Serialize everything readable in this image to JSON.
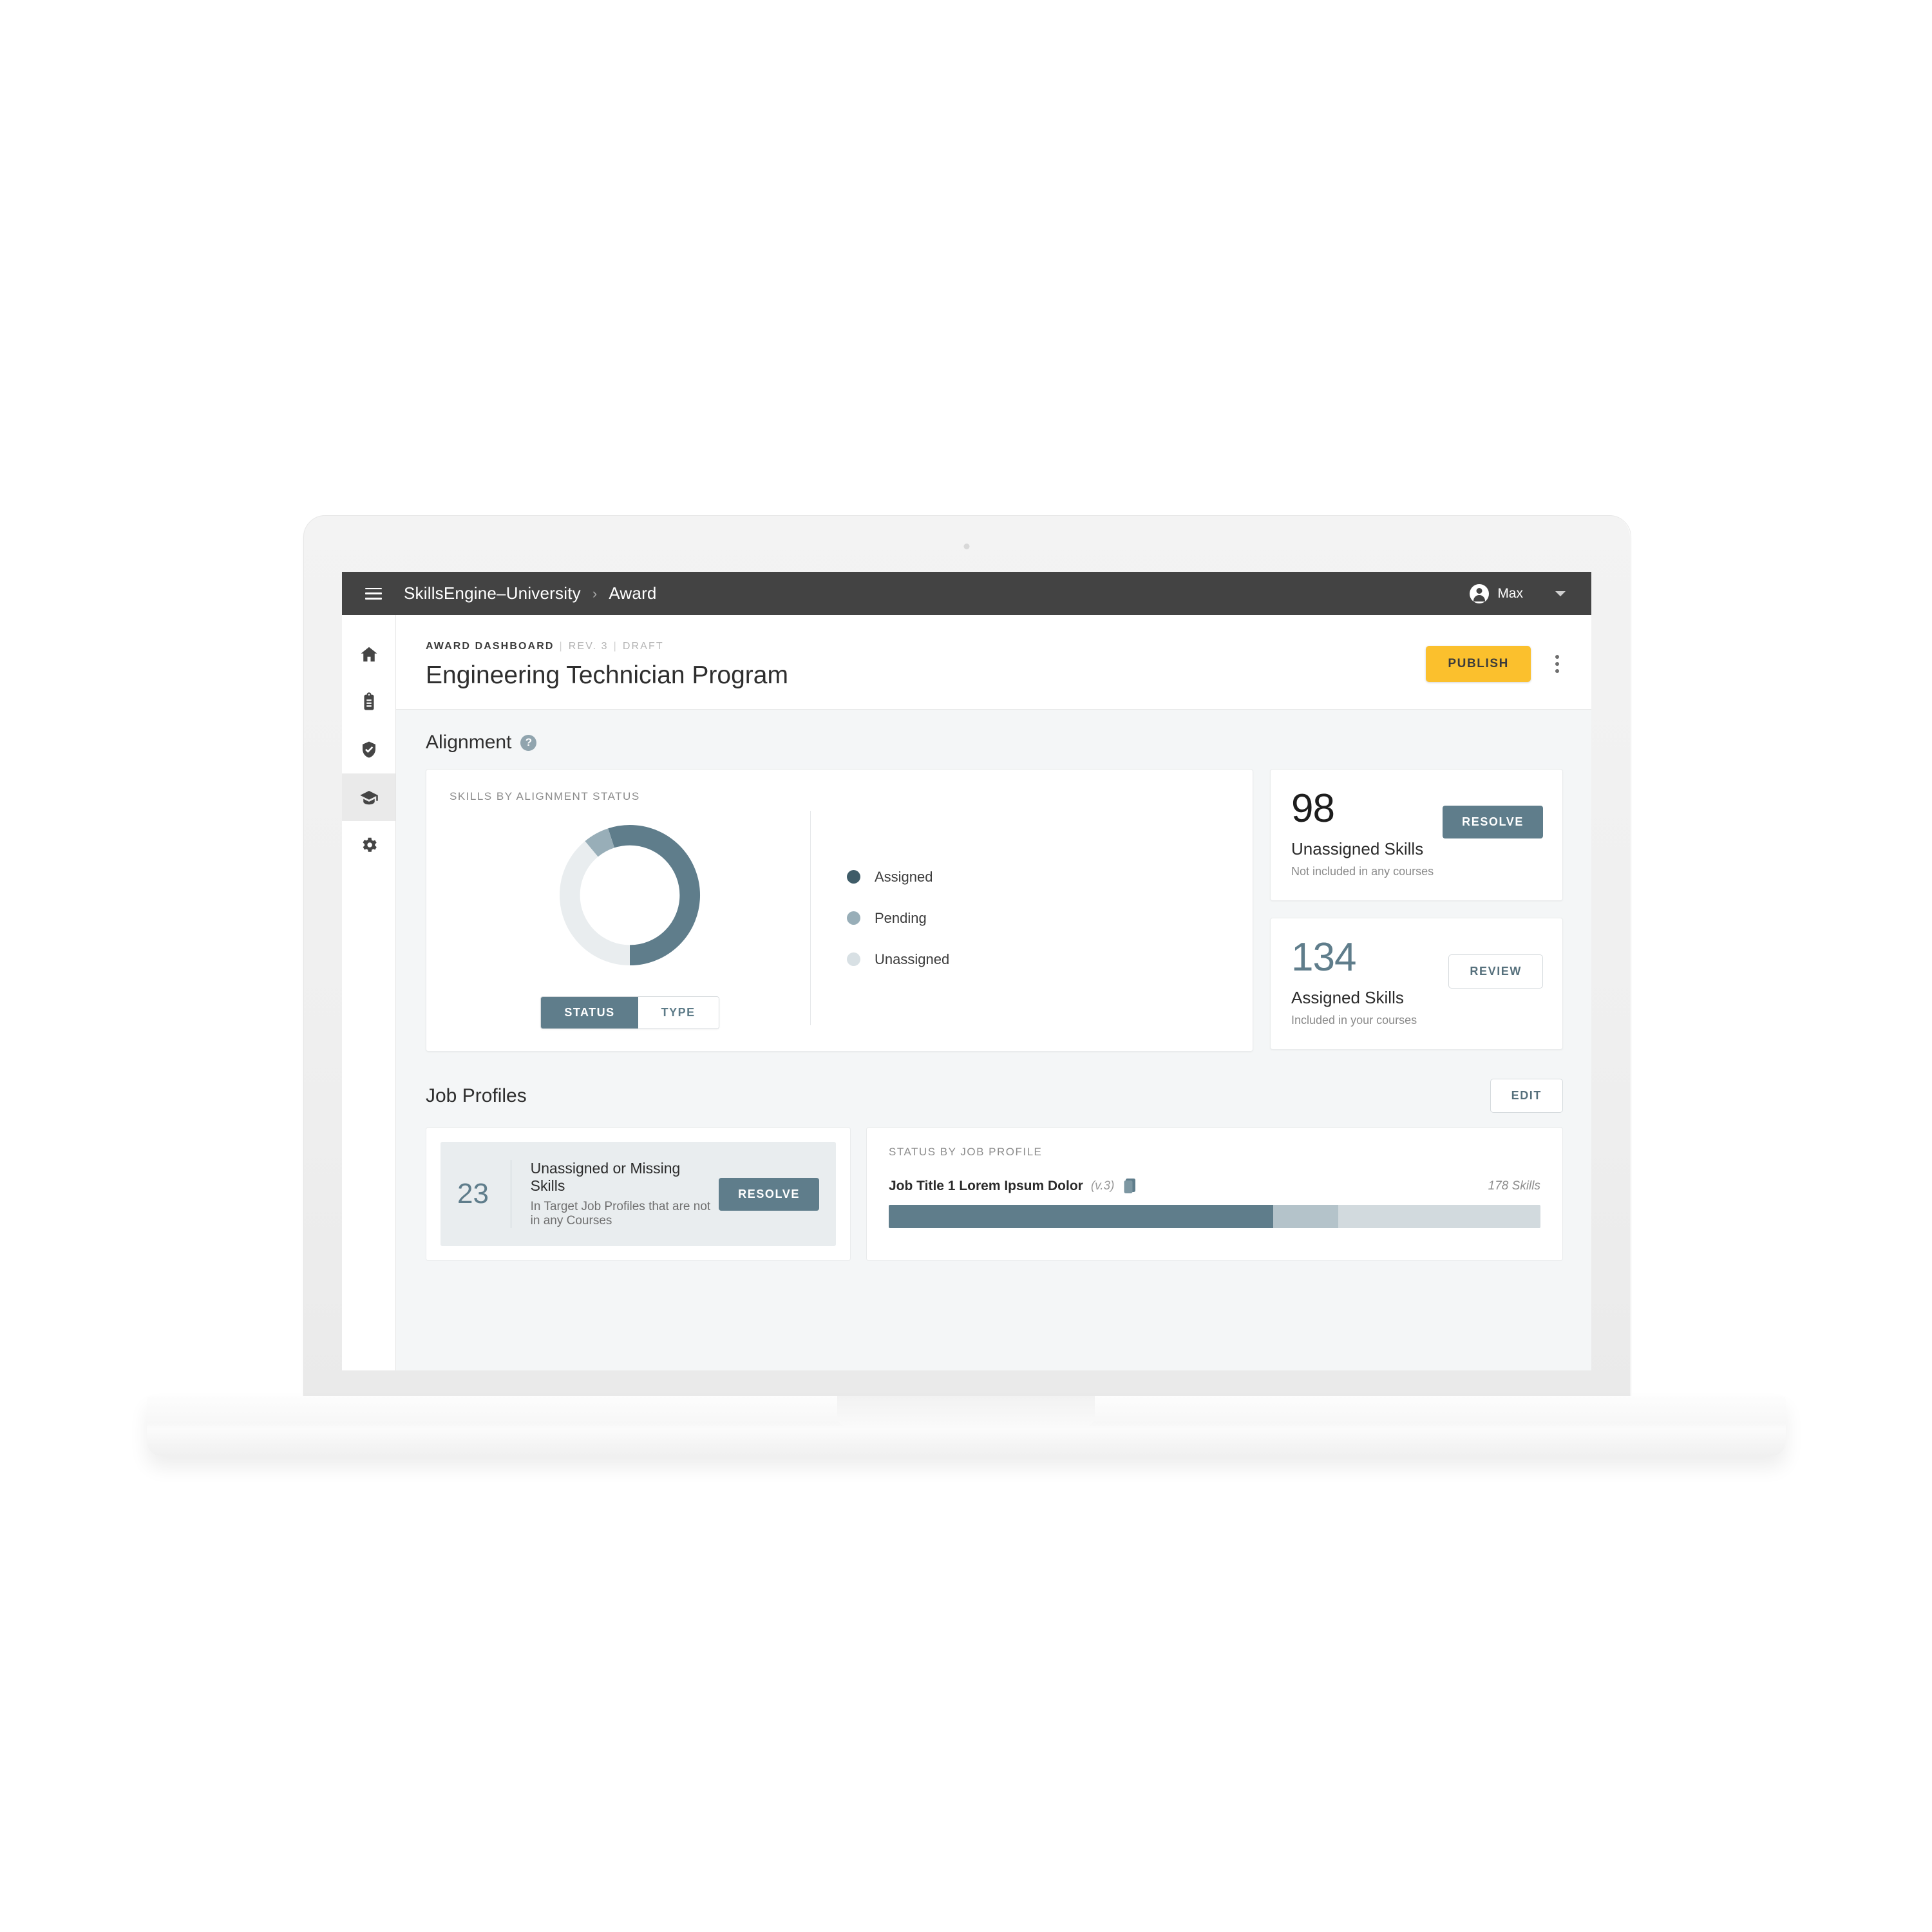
{
  "topbar": {
    "menu_icon": "hamburger-icon",
    "breadcrumb": {
      "root": "SkillsEngine–University",
      "separator": "›",
      "current": "Award"
    },
    "user": {
      "name": "Max",
      "avatar_icon": "account-circle-icon",
      "caret_icon": "chevron-down-icon"
    }
  },
  "sidebar": {
    "items": [
      {
        "name": "home",
        "icon": "home-icon",
        "active": false
      },
      {
        "name": "clipboard",
        "icon": "clipboard-icon",
        "active": false
      },
      {
        "name": "verified",
        "icon": "shield-check-icon",
        "active": false
      },
      {
        "name": "awards",
        "icon": "graduation-cap-icon",
        "active": true
      },
      {
        "name": "settings",
        "icon": "gear-icon",
        "active": false
      }
    ]
  },
  "page_header": {
    "eyebrow_main": "AWARD DASHBOARD",
    "eyebrow_rev": "REV. 3",
    "eyebrow_status": "DRAFT",
    "pipe": "|",
    "title": "Engineering Technician Program",
    "publish_label": "PUBLISH",
    "more_icon": "kebab-menu-icon"
  },
  "alignment": {
    "title": "Alignment",
    "help_icon": "help-circle-icon",
    "chart_card_label": "SKILLS BY ALIGNMENT STATUS",
    "toggle": {
      "options": [
        "STATUS",
        "TYPE"
      ],
      "selected": "STATUS"
    },
    "legend": [
      {
        "label": "Assigned",
        "color": "#3f5c68"
      },
      {
        "label": "Pending",
        "color": "#98aeb8"
      },
      {
        "label": "Unassigned",
        "color": "#d8e0e4"
      }
    ],
    "stats": [
      {
        "value": "98",
        "title": "Unassigned Skills",
        "subtitle": "Not included in any courses",
        "button": "RESOLVE",
        "button_style": "solid",
        "value_color": "#1d1d1d"
      },
      {
        "value": "134",
        "title": "Assigned Skills",
        "subtitle": "Included in your courses",
        "button": "REVIEW",
        "button_style": "outline",
        "value_color": "#5f7d8b"
      }
    ]
  },
  "job_profiles": {
    "title": "Job Profiles",
    "edit_label": "EDIT",
    "summary": {
      "count": "23",
      "title": "Unassigned or Missing Skills",
      "subtitle": "In Target Job Profiles that are not in any Courses",
      "button": "RESOLVE"
    },
    "status_card_label": "STATUS BY JOB PROFILE",
    "rows": [
      {
        "name": "Job Title 1 Lorem Ipsum Dolor",
        "version": "(v.3)",
        "copy_icon": "copy-icon",
        "count": "178 Skills",
        "segments": [
          {
            "label": "Assigned",
            "pct": 59,
            "color": "#5f7d8b"
          },
          {
            "label": "Pending",
            "pct": 10,
            "color": "#b4c3ca"
          },
          {
            "label": "Unassigned",
            "pct": 31,
            "color": "#d2dade"
          }
        ]
      }
    ]
  },
  "chart_data": {
    "type": "pie",
    "title": "SKILLS BY ALIGNMENT STATUS",
    "variant": "donut",
    "categories": [
      "Assigned",
      "Pending",
      "Unassigned"
    ],
    "values": [
      55,
      6,
      39
    ],
    "colors": [
      "#5f7d8b",
      "#98aeb8",
      "#e9edef"
    ],
    "units": "percent",
    "legend_position": "right",
    "start_angle_deg": 0,
    "direction": "counter-clockwise",
    "grid": false
  }
}
